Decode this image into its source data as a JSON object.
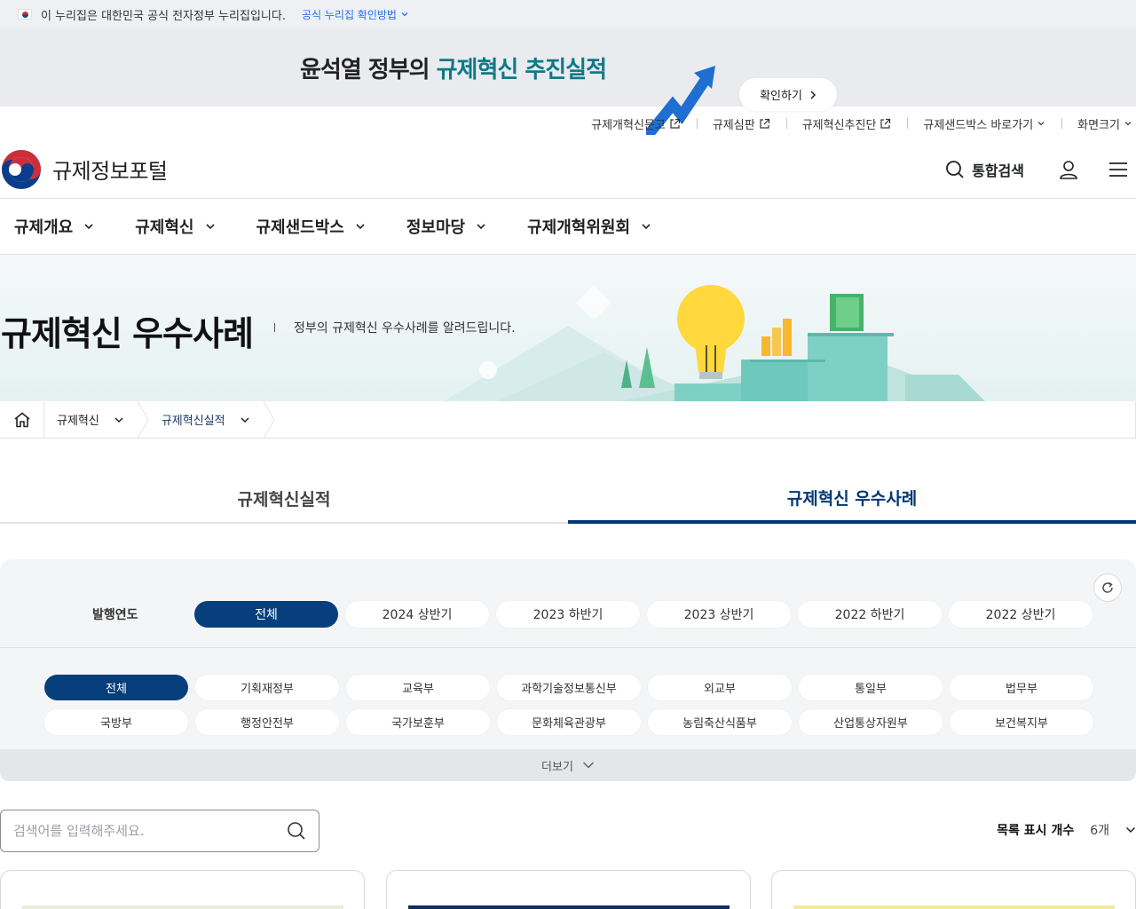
{
  "gov_strip": {
    "text": "이 누리집은 대한민국 공식 전자정부 누리집입니다.",
    "link": "공식 누리집 확인방법"
  },
  "banner": {
    "text_a": "윤석열 정부의 ",
    "text_b": "규제혁신 추진실적",
    "button": "확인하기",
    "accent_color": "#0d7a86"
  },
  "utility": [
    {
      "label": "규제개혁신문고",
      "icon": "external-link-icon"
    },
    {
      "label": "규제심판",
      "icon": "external-link-icon"
    },
    {
      "label": "규제혁신추진단",
      "icon": "external-link-icon"
    },
    {
      "label": "규제샌드박스 바로가기",
      "icon": "chevron-down-icon"
    },
    {
      "label": "화면크기",
      "icon": "chevron-down-icon"
    }
  ],
  "header": {
    "logo_title": "규제정보포털",
    "search_label": "통합검색"
  },
  "gnb": [
    "규제개요",
    "규제혁신",
    "규제샌드박스",
    "정보마당",
    "규제개혁위원회"
  ],
  "hero": {
    "title": "규제혁신 우수사례",
    "desc": "정부의 규제혁신 우수사례를 알려드립니다."
  },
  "breadcrumb": [
    "규제혁신",
    "규제혁신실적"
  ],
  "tabs": [
    {
      "label": "규제혁신실적",
      "active": false
    },
    {
      "label": "규제혁신 우수사례",
      "active": true
    }
  ],
  "filter": {
    "year_label": "발행연도",
    "years": [
      "전체",
      "2024 상반기",
      "2023 하반기",
      "2023 상반기",
      "2022 하반기",
      "2022 상반기"
    ],
    "selected_year": "전체",
    "departments": [
      "전체",
      "기획재정부",
      "교육부",
      "과학기술정보통신부",
      "외교부",
      "통일부",
      "법무부",
      "국방부",
      "행정안전부",
      "국가보훈부",
      "문화체육관광부",
      "농림축산식품부",
      "산업통상자원부",
      "보건복지부"
    ],
    "selected_department": "전체",
    "more": "더보기"
  },
  "list": {
    "search_placeholder": "검색어를 입력해주세요.",
    "count_label": "목록 표시 개수",
    "count_value": "6개"
  },
  "colors": {
    "primary": "#063f7c",
    "tab_active": "#003675"
  }
}
